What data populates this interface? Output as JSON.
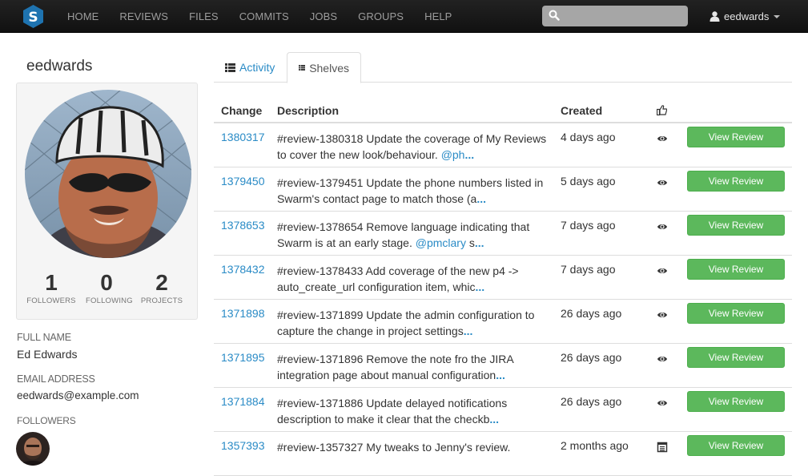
{
  "navbar": {
    "logo_letter": "S",
    "links": [
      "HOME",
      "REVIEWS",
      "FILES",
      "COMMITS",
      "JOBS",
      "GROUPS",
      "HELP"
    ],
    "search_value": "",
    "search_placeholder": "",
    "user": "eedwards",
    "colors": {
      "bar": "#1b1b1b",
      "link": "#9d9d9d",
      "logo": "#1e73b0"
    }
  },
  "profile": {
    "username": "eedwards",
    "stats": [
      {
        "value": "1",
        "label": "FOLLOWERS"
      },
      {
        "value": "0",
        "label": "FOLLOWING"
      },
      {
        "value": "2",
        "label": "PROJECTS"
      }
    ],
    "full_name_label": "FULL NAME",
    "full_name": "Ed Edwards",
    "email_label": "EMAIL ADDRESS",
    "email": "eedwards@example.com",
    "followers_label": "FOLLOWERS"
  },
  "tabs": {
    "activity": "Activity",
    "shelves": "Shelves",
    "active": "shelves"
  },
  "table": {
    "headers": {
      "change": "Change",
      "description": "Description",
      "created": "Created",
      "votes_icon": "thumbs-up-icon"
    },
    "button_label": "View Review",
    "button_color": "#5cb85c",
    "link_color": "#2a8bc6",
    "rows": [
      {
        "change": "1380317",
        "desc_line1": "#review-1380318 Update the coverage of My Reviews",
        "desc_line2": "to cover the new look/behaviour. ",
        "mention": "@ph",
        "more": "...",
        "created": "4 days ago",
        "icon": "eye-icon"
      },
      {
        "change": "1379450",
        "desc_line1": "#review-1379451 Update the phone numbers listed in",
        "desc_line2": "Swarm's contact page to match those (a",
        "mention": "",
        "more": "...",
        "created": "5 days ago",
        "icon": "eye-icon"
      },
      {
        "change": "1378653",
        "desc_line1": "#review-1378654 Remove language indicating that",
        "desc_line2": "Swarm is at an early stage. ",
        "mention": "@pmclary",
        "tail": " s",
        "more": "...",
        "created": "7 days ago",
        "icon": "eye-icon"
      },
      {
        "change": "1378432",
        "desc_line1": "#review-1378433 Add coverage of the new p4 ->",
        "desc_line2": "auto_create_url configuration item, whic",
        "mention": "",
        "more": "...",
        "created": "7 days ago",
        "icon": "eye-icon"
      },
      {
        "change": "1371898",
        "desc_line1": "#review-1371899 Update the admin configuration to",
        "desc_line2": "capture the change in project settings",
        "mention": "",
        "more": "...",
        "created": "26 days ago",
        "icon": "eye-icon"
      },
      {
        "change": "1371895",
        "desc_line1": "#review-1371896 Remove the note fro the JIRA",
        "desc_line2": "integration page about manual configuration",
        "mention": "",
        "more": "...",
        "created": "26 days ago",
        "icon": "eye-icon"
      },
      {
        "change": "1371884",
        "desc_line1": "#review-1371886 Update delayed notifications",
        "desc_line2": "description to make it clear that the checkb",
        "mention": "",
        "more": "...",
        "created": "26 days ago",
        "icon": "eye-icon"
      },
      {
        "change": "1357393",
        "desc_line1": "#review-1357327 My tweaks to Jenny's review.",
        "desc_line2": "",
        "mention": "",
        "more": "",
        "created": "2 months ago",
        "icon": "list-alt-icon"
      }
    ]
  }
}
